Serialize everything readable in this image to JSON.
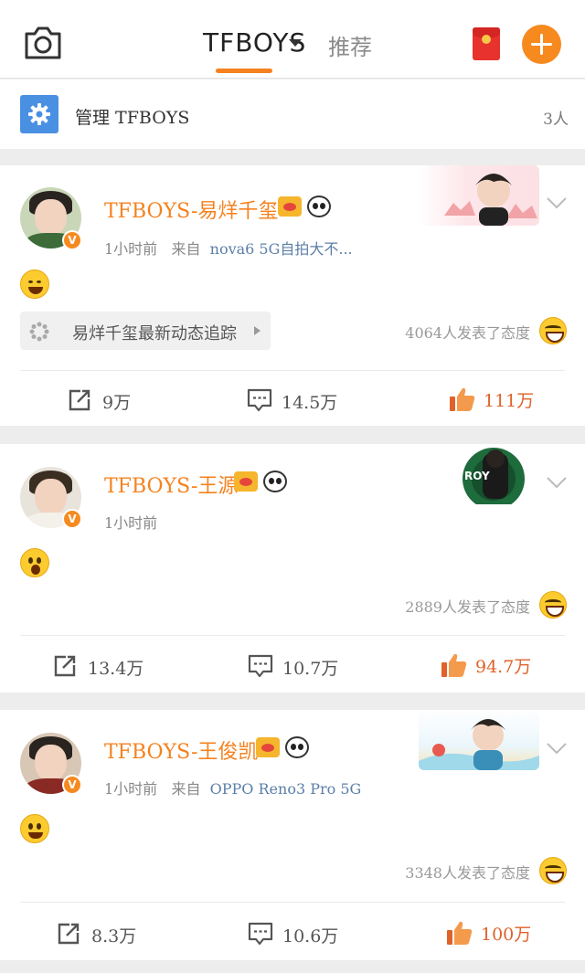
{
  "topbar": {
    "tab_active": "TFBOYS",
    "tab_other": "推荐",
    "icons": {
      "camera": "camera-icon",
      "red_packet": "red-packet-icon",
      "compose": "plus-icon"
    },
    "accent": "#f5821f"
  },
  "manage": {
    "label": "管理 TFBOYS",
    "count": "3人"
  },
  "posts": [
    {
      "name": "TFBOYS-易烊千玺",
      "time": "1小时前",
      "from_label": "来自",
      "source": "nova6 5G自拍大不...",
      "emoji": "laughing-emoji",
      "track_label": "易烊千玺最新动态追踪",
      "attitude": "4064人发表了态度",
      "repost": "9万",
      "comment": "14.5万",
      "like": "111万"
    },
    {
      "name": "TFBOYS-王源",
      "time": "1小时前",
      "emoji": "surprised-emoji",
      "banner_text": "ROY",
      "attitude": "2889人发表了态度",
      "repost": "13.4万",
      "comment": "10.7万",
      "like": "94.7万"
    },
    {
      "name": "TFBOYS-王俊凯",
      "time": "1小时前",
      "from_label": "来自",
      "source": "OPPO Reno3 Pro 5G",
      "emoji": "smile-emoji",
      "attitude": "3348人发表了态度",
      "repost": "8.3万",
      "comment": "10.6万",
      "like": "100万"
    }
  ]
}
